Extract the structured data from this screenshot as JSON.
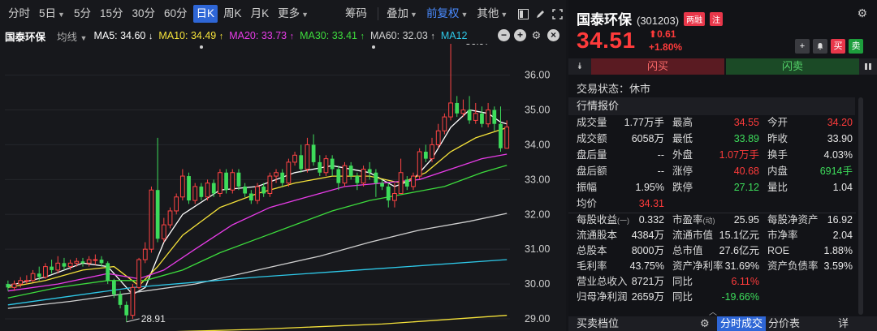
{
  "toolbar": {
    "periods": [
      "分时",
      "5日",
      "5分",
      "15分",
      "30分",
      "60分",
      "日K",
      "周K",
      "月K",
      "更多"
    ],
    "active": "日K",
    "chip": "筹码",
    "overlay": "叠加",
    "adjust": "前复权",
    "other": "其他"
  },
  "mabar": {
    "stock_name": "国泰环保",
    "mode": "均线",
    "ma": [
      {
        "label": "MA5: 34.60",
        "color": "#ffffff",
        "arrow": "↓"
      },
      {
        "label": "MA10: 34.49",
        "color": "#f5e23a",
        "arrow": "↑"
      },
      {
        "label": "MA20: 33.73",
        "color": "#e83ce8",
        "arrow": "↑"
      },
      {
        "label": "MA30: 33.41",
        "color": "#3ddc3d",
        "arrow": "↑"
      },
      {
        "label": "MA60: 32.03",
        "color": "#cfcfcf",
        "arrow": "↑"
      },
      {
        "label": "MA12",
        "color": "#2ec8e8",
        "arrow": ""
      }
    ]
  },
  "chart_data": {
    "type": "candlestick",
    "yticks": [
      "36.00",
      "35.00",
      "34.00",
      "33.00",
      "32.00",
      "31.00",
      "30.00",
      "29.00"
    ],
    "ylim": [
      28.65,
      36.9
    ],
    "high_label": "36.97",
    "low_label": "28.91",
    "candles": [
      [
        30.0,
        29.9,
        30.1,
        29.8
      ],
      [
        29.9,
        30.0,
        30.1,
        29.8
      ],
      [
        30.0,
        30.1,
        30.2,
        29.9
      ],
      [
        30.1,
        30.1,
        30.25,
        30.0
      ],
      [
        30.1,
        30.3,
        30.4,
        30.05
      ],
      [
        30.3,
        30.2,
        30.5,
        30.1
      ],
      [
        30.2,
        30.5,
        30.6,
        30.15
      ],
      [
        30.5,
        30.4,
        30.7,
        30.3
      ],
      [
        30.4,
        30.6,
        30.8,
        30.3
      ],
      [
        30.6,
        30.5,
        30.75,
        30.4
      ],
      [
        30.5,
        30.6,
        30.7,
        30.4
      ],
      [
        30.6,
        30.65,
        30.75,
        30.5
      ],
      [
        30.65,
        30.6,
        30.75,
        30.5
      ],
      [
        30.6,
        30.7,
        30.8,
        30.5
      ],
      [
        30.7,
        30.7,
        30.85,
        30.55
      ],
      [
        30.7,
        30.6,
        30.8,
        30.5
      ],
      [
        30.6,
        30.1,
        30.65,
        30.0
      ],
      [
        30.1,
        29.7,
        30.15,
        29.6
      ],
      [
        29.7,
        29.4,
        29.8,
        29.3
      ],
      [
        29.4,
        29.1,
        29.5,
        28.91
      ],
      [
        29.1,
        29.9,
        30.0,
        29.0
      ],
      [
        29.9,
        30.7,
        30.75,
        29.85
      ],
      [
        30.7,
        31.0,
        31.2,
        30.6
      ],
      [
        31.0,
        32.7,
        32.8,
        30.9
      ],
      [
        32.7,
        31.3,
        34.2,
        31.2
      ],
      [
        31.3,
        31.7,
        31.9,
        31.2
      ],
      [
        31.7,
        32.1,
        32.2,
        31.6
      ],
      [
        32.1,
        32.5,
        32.6,
        32.0
      ],
      [
        32.5,
        33.1,
        33.3,
        32.4
      ],
      [
        33.1,
        32.4,
        33.2,
        32.3
      ],
      [
        32.4,
        32.8,
        32.9,
        32.3
      ],
      [
        32.8,
        32.5,
        32.9,
        32.4
      ],
      [
        32.5,
        32.9,
        33.0,
        32.4
      ],
      [
        32.9,
        32.6,
        33.0,
        32.5
      ],
      [
        32.6,
        33.2,
        33.3,
        32.5
      ],
      [
        33.2,
        32.7,
        33.3,
        32.6
      ],
      [
        32.7,
        33.2,
        33.3,
        32.6
      ],
      [
        33.2,
        32.8,
        33.3,
        32.7
      ],
      [
        32.8,
        32.6,
        32.9,
        32.5
      ],
      [
        32.6,
        32.4,
        32.7,
        32.3
      ],
      [
        32.4,
        32.8,
        32.9,
        32.3
      ],
      [
        32.8,
        32.6,
        32.9,
        32.5
      ],
      [
        32.6,
        33.1,
        33.2,
        32.5
      ],
      [
        33.1,
        33.2,
        33.3,
        32.9
      ],
      [
        33.2,
        32.9,
        33.3,
        32.8
      ],
      [
        32.9,
        33.5,
        33.6,
        32.8
      ],
      [
        33.5,
        33.7,
        33.8,
        33.4
      ],
      [
        33.7,
        33.3,
        34.0,
        33.2
      ],
      [
        33.3,
        34.0,
        34.2,
        33.2
      ],
      [
        34.0,
        33.5,
        34.3,
        33.4
      ],
      [
        33.5,
        33.2,
        33.7,
        33.1
      ],
      [
        33.2,
        33.6,
        33.7,
        33.1
      ],
      [
        33.6,
        33.3,
        33.7,
        33.1
      ],
      [
        33.3,
        32.9,
        33.4,
        32.7
      ],
      [
        32.9,
        33.4,
        33.5,
        32.8
      ],
      [
        33.4,
        33.1,
        33.5,
        33.0
      ],
      [
        33.1,
        32.9,
        33.2,
        32.7
      ],
      [
        32.9,
        33.3,
        33.4,
        32.8
      ],
      [
        33.3,
        33.2,
        33.5,
        33.0
      ],
      [
        33.2,
        32.9,
        33.3,
        32.5
      ],
      [
        32.9,
        32.8,
        33.0,
        32.7
      ],
      [
        32.8,
        32.4,
        32.9,
        32.2
      ],
      [
        32.4,
        32.6,
        32.9,
        32.2
      ],
      [
        32.6,
        33.2,
        33.6,
        32.9
      ],
      [
        33.0,
        32.8,
        33.1,
        32.7
      ],
      [
        32.8,
        33.1,
        33.2,
        32.7
      ],
      [
        33.1,
        33.8,
        33.9,
        33.0
      ],
      [
        33.8,
        33.6,
        34.0,
        33.5
      ],
      [
        33.6,
        34.0,
        34.2,
        33.5
      ],
      [
        34.0,
        34.4,
        34.6,
        33.9
      ],
      [
        34.4,
        34.8,
        34.9,
        34.3
      ],
      [
        34.8,
        35.2,
        36.97,
        34.7
      ],
      [
        35.2,
        34.9,
        35.4,
        34.8
      ],
      [
        34.9,
        35.0,
        35.3,
        34.8
      ],
      [
        35.0,
        34.7,
        35.4,
        34.6
      ],
      [
        34.7,
        34.9,
        35.2,
        34.6
      ],
      [
        34.9,
        34.6,
        35.1,
        34.5
      ],
      [
        34.6,
        35.0,
        35.2,
        34.5
      ],
      [
        35.0,
        34.6,
        35.1,
        34.4
      ],
      [
        34.6,
        33.9,
        35.1,
        33.8
      ],
      [
        33.9,
        34.51,
        34.7,
        33.89
      ]
    ],
    "ma_lines": [
      {
        "name": "MA5",
        "color": "#ffffff",
        "points": [
          [
            0,
            29.95
          ],
          [
            6,
            30.2
          ],
          [
            12,
            30.6
          ],
          [
            16,
            30.5
          ],
          [
            20,
            29.7
          ],
          [
            22,
            29.9
          ],
          [
            25,
            31.2
          ],
          [
            28,
            32.0
          ],
          [
            34,
            32.7
          ],
          [
            40,
            32.8
          ],
          [
            46,
            33.2
          ],
          [
            52,
            33.4
          ],
          [
            58,
            33.2
          ],
          [
            62,
            32.8
          ],
          [
            65,
            33.0
          ],
          [
            68,
            33.6
          ],
          [
            71,
            34.5
          ],
          [
            74,
            35.0
          ],
          [
            77,
            34.9
          ],
          [
            79,
            34.65
          ],
          [
            80,
            34.6
          ]
        ]
      },
      {
        "name": "MA10",
        "color": "#f5e23a",
        "points": [
          [
            0,
            29.9
          ],
          [
            6,
            30.1
          ],
          [
            12,
            30.4
          ],
          [
            17,
            30.5
          ],
          [
            21,
            29.95
          ],
          [
            24,
            30.5
          ],
          [
            28,
            31.4
          ],
          [
            34,
            32.2
          ],
          [
            40,
            32.6
          ],
          [
            46,
            32.9
          ],
          [
            52,
            33.1
          ],
          [
            58,
            33.1
          ],
          [
            63,
            32.9
          ],
          [
            67,
            33.2
          ],
          [
            71,
            33.8
          ],
          [
            75,
            34.2
          ],
          [
            80,
            34.49
          ]
        ]
      },
      {
        "name": "MA20",
        "color": "#e83ce8",
        "points": [
          [
            0,
            29.8
          ],
          [
            8,
            30.0
          ],
          [
            16,
            30.3
          ],
          [
            21,
            30.15
          ],
          [
            25,
            30.4
          ],
          [
            30,
            31.0
          ],
          [
            36,
            31.7
          ],
          [
            42,
            32.2
          ],
          [
            48,
            32.5
          ],
          [
            54,
            32.8
          ],
          [
            60,
            32.9
          ],
          [
            66,
            33.0
          ],
          [
            71,
            33.3
          ],
          [
            76,
            33.6
          ],
          [
            80,
            33.73
          ]
        ]
      },
      {
        "name": "MA30",
        "color": "#3ddc3d",
        "points": [
          [
            0,
            29.6
          ],
          [
            8,
            29.9
          ],
          [
            16,
            30.1
          ],
          [
            22,
            30.1
          ],
          [
            28,
            30.4
          ],
          [
            34,
            30.9
          ],
          [
            40,
            31.3
          ],
          [
            46,
            31.7
          ],
          [
            52,
            32.1
          ],
          [
            58,
            32.4
          ],
          [
            64,
            32.6
          ],
          [
            70,
            32.8
          ],
          [
            76,
            33.2
          ],
          [
            80,
            33.41
          ]
        ]
      },
      {
        "name": "MA60",
        "color": "#cfcfcf",
        "points": [
          [
            0,
            29.3
          ],
          [
            10,
            29.5
          ],
          [
            20,
            29.75
          ],
          [
            30,
            30.0
          ],
          [
            40,
            30.4
          ],
          [
            50,
            30.8
          ],
          [
            58,
            31.2
          ],
          [
            66,
            31.55
          ],
          [
            74,
            31.8
          ],
          [
            80,
            32.03
          ]
        ]
      },
      {
        "name": "MA12",
        "color": "#2ec8e8",
        "points": [
          [
            0,
            29.4
          ],
          [
            20,
            29.9
          ],
          [
            40,
            30.2
          ],
          [
            60,
            30.45
          ],
          [
            80,
            30.7
          ]
        ]
      },
      {
        "name": "MA250",
        "color": "#f5e23a",
        "points": [
          [
            20,
            28.6
          ],
          [
            40,
            28.7
          ],
          [
            60,
            28.85
          ],
          [
            80,
            29.1
          ]
        ]
      }
    ]
  },
  "quote": {
    "name": "国泰环保",
    "code": "(301203)",
    "badge1": "两融",
    "badge2": "注",
    "price": "34.51",
    "change": "0.61",
    "change_pct": "+1.80%",
    "buy_label": "闪买",
    "sell_label": "闪卖",
    "btn_plus": "+",
    "btn_buy": "买",
    "btn_sell": "卖",
    "status": "交易状态：休市",
    "section_quote": "行情报价",
    "section_book": "买卖档位",
    "tab_tick": "分时成交",
    "tab_dist": "分价表",
    "tab_detail": "详",
    "rows1": [
      [
        {
          "l": "成交量",
          "v": "1.77万手",
          "c": "w"
        },
        {
          "l": "最高",
          "v": "34.55",
          "c": "r"
        },
        {
          "l": "今开",
          "v": "34.20",
          "c": "r"
        }
      ],
      [
        {
          "l": "成交额",
          "v": "6058万",
          "c": "w"
        },
        {
          "l": "最低",
          "v": "33.89",
          "c": "g"
        },
        {
          "l": "昨收",
          "v": "33.90",
          "c": "w"
        }
      ],
      [
        {
          "l": "盘后量",
          "v": "--",
          "c": "w"
        },
        {
          "l": "外盘",
          "v": "1.07万手",
          "c": "r"
        },
        {
          "l": "换手",
          "v": "4.03%",
          "c": "w"
        }
      ],
      [
        {
          "l": "盘后额",
          "v": "--",
          "c": "w"
        },
        {
          "l": "涨停",
          "v": "40.68",
          "c": "r"
        },
        {
          "l": "内盘",
          "v": "6914手",
          "c": "g"
        }
      ],
      [
        {
          "l": "振幅",
          "v": "1.95%",
          "c": "w"
        },
        {
          "l": "跌停",
          "v": "27.12",
          "c": "g"
        },
        {
          "l": "量比",
          "v": "1.04",
          "c": "w"
        }
      ],
      [
        {
          "l": "均价",
          "v": "34.31",
          "c": "r"
        }
      ]
    ],
    "rows2": [
      [
        {
          "l": "每股收益",
          "s": "(一)",
          "v": "0.332"
        },
        {
          "l": "市盈率",
          "s": "(动)",
          "v": "25.95"
        },
        {
          "l": "每股净资产",
          "v": "16.92"
        }
      ],
      [
        {
          "l": "流通股本",
          "v": "4384万"
        },
        {
          "l": "流通市值",
          "v": "15.1亿元"
        },
        {
          "l": "市净率",
          "v": "2.04"
        }
      ],
      [
        {
          "l": "总股本",
          "v": "8000万"
        },
        {
          "l": "总市值",
          "v": "27.6亿元"
        },
        {
          "l": "ROE",
          "v": "1.88%"
        }
      ],
      [
        {
          "l": "毛利率",
          "v": "43.75%"
        },
        {
          "l": "资产净利率",
          "v": "31.69%"
        },
        {
          "l": "资产负债率",
          "v": "3.59%"
        }
      ],
      [
        {
          "l": "营业总收入",
          "v": "8721万"
        },
        {
          "l": "同比",
          "v": "6.11%",
          "c": "r"
        }
      ],
      [
        {
          "l": "归母净利润",
          "v": "2659万"
        },
        {
          "l": "同比",
          "v": "-19.66%",
          "c": "g"
        }
      ]
    ]
  }
}
